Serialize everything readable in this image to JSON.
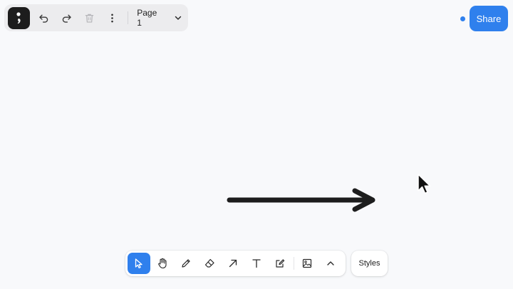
{
  "menu": {
    "logo_glyph": ";",
    "undo_icon": "undo-icon",
    "redo_icon": "redo-icon",
    "delete_icon": "trash-icon",
    "more_icon": "more-vertical-icon",
    "page_name": "Page 1",
    "page_dropdown_icon": "chevron-down-icon"
  },
  "share": {
    "label": "Share",
    "status_dot_color": "#2f80ed",
    "button_color": "#2f80ed"
  },
  "toolbar": {
    "tools": [
      {
        "name": "select",
        "icon": "cursor-icon",
        "active": true
      },
      {
        "name": "hand",
        "icon": "hand-icon",
        "active": false
      },
      {
        "name": "draw",
        "icon": "pencil-icon",
        "active": false
      },
      {
        "name": "eraser",
        "icon": "eraser-icon",
        "active": false
      },
      {
        "name": "arrow",
        "icon": "arrow-icon",
        "active": false
      },
      {
        "name": "text",
        "icon": "text-icon",
        "active": false
      },
      {
        "name": "note",
        "icon": "note-icon",
        "active": false
      },
      {
        "name": "image",
        "icon": "image-icon",
        "active": false
      },
      {
        "name": "more",
        "icon": "chevron-up-icon",
        "active": false
      }
    ],
    "accent": "#2f80ed",
    "styles_label": "Styles"
  },
  "canvas": {
    "shapes": [
      {
        "type": "arrow",
        "color": "#1d1d1d"
      }
    ]
  }
}
